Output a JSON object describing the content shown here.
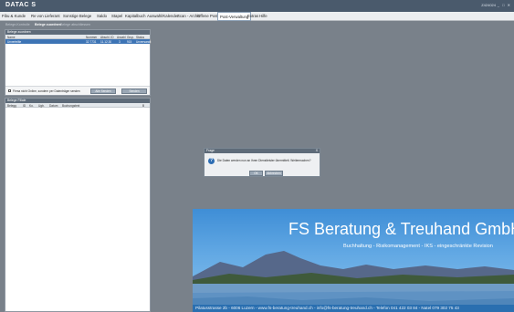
{
  "app": {
    "brand": "DATAC S",
    "window_id": "Z424024",
    "window_controls": "_ □ ✕"
  },
  "menu": {
    "items": [
      "Fibu & Kunde",
      "Re von Lieferant",
      "Sonstige Belege",
      "Saldo",
      "Stapel",
      "Kapitalbuch",
      "Auswahl/Kalender",
      "Scan - Archiv",
      "Offene Posten",
      "Post-Verwaltung",
      "Extras",
      "Hilfe"
    ],
    "active": "Post-Verwaltung"
  },
  "tabs": [
    "Belege-Kontrolle",
    "Belege zuordnen",
    "Belege abschliessen"
  ],
  "top_panel": {
    "title": "Belege zuordnen",
    "columns": [
      "Name",
      "Nummer",
      "Abschl. ID",
      "Anzahl",
      "Grup.",
      "Status"
    ],
    "selected_row": [
      "Unverteilte",
      "32 7731",
      "11.12.30",
      "3",
      "915",
      "Unversandt"
    ],
    "checkbox_label": "Firma nicht Online, sondern per Datenträger senden",
    "button_1": "Alle Senden",
    "button_2": "Senden"
  },
  "bottom_panel": {
    "title": "Belege Filiale",
    "columns": [
      "Belegg",
      "ID",
      "Ko.",
      "Ugb.",
      "Datum",
      "Buchungstext"
    ],
    "last_column": "B"
  },
  "dialog": {
    "title": "Frage",
    "close": "X",
    "icon": "question-icon",
    "message": "Die Daten werden nun an Ihren Dienstleister übermittelt. Weitermachen?",
    "ok_label": "OK",
    "cancel_label": "Abbrechen"
  },
  "website": {
    "company_name": "FS Beratung & Treuhand GmbH",
    "services": "Buchhaltung - Risikomanagement - IKS - eingeschränkte Revision",
    "footer": "Pilatusstrasse 2b - 6006 Luzern - www.fs-beratung-treuhand.ch - info@fs-beratung-treuhand.ch - Telefon 041 422 03 84 - Natel 079 302 75 43"
  }
}
